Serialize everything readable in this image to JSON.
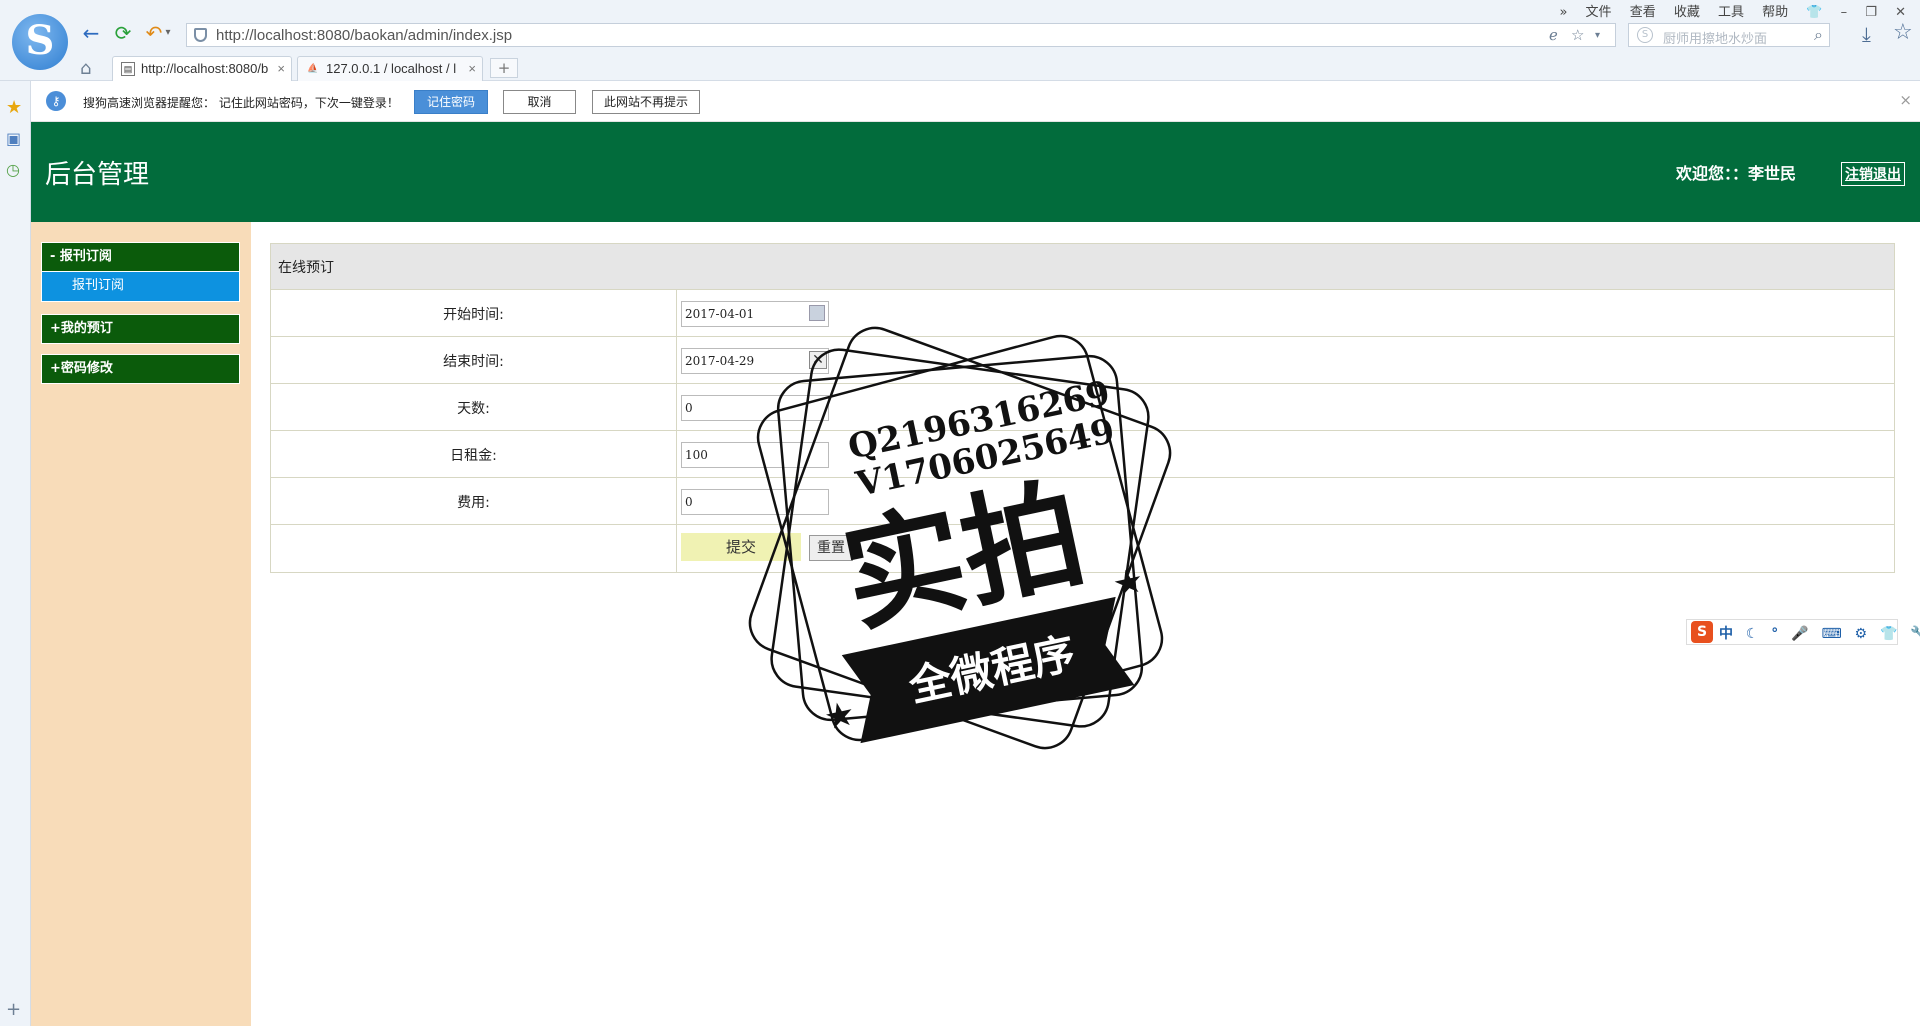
{
  "browser": {
    "url": "http://localhost:8080/baokan/admin/index.jsp",
    "search_placeholder": "厨师用擦地水炒面",
    "menu": [
      "文件",
      "查看",
      "收藏",
      "工具",
      "帮助"
    ],
    "tabs": [
      {
        "label": "http://localhost:8080/b",
        "close": "×"
      },
      {
        "label": "127.0.0.1 / localhost / l",
        "close": "×"
      }
    ],
    "new_tab": "+"
  },
  "infobar": {
    "message": "搜狗高速浏览器提醒您： 记住此网站密码，下次一键登录！",
    "remember": "记住密码",
    "cancel": "取消",
    "never": "此网站不再提示",
    "close": "×"
  },
  "header": {
    "title": "后台管理",
    "welcome": "欢迎您：：李世民",
    "logout": "注销退出"
  },
  "sidebar": {
    "items": [
      {
        "label": "- 报刊订阅",
        "sub": "报刊订阅"
      },
      {
        "label": "+我的预订"
      },
      {
        "label": "+密码修改"
      }
    ]
  },
  "form": {
    "title": "在线预订",
    "fields": [
      {
        "label": "开始时间:",
        "value": "2017-04-01"
      },
      {
        "label": "结束时间:",
        "value": "2017-04-29"
      },
      {
        "label": "天数:",
        "value": "0"
      },
      {
        "label": "日租金:",
        "value": "100"
      },
      {
        "label": "费用:",
        "value": "0"
      }
    ],
    "submit": "提交",
    "reset": "重置"
  },
  "ime": {
    "logo": "S",
    "label": "中"
  },
  "watermark": {
    "line1": "Q2196316269",
    "line2": "V1706025649",
    "main": "实拍",
    "banner": "全微程序"
  },
  "colors": {
    "header_bg": "#026c3c",
    "menu_head": "#0b5b0b",
    "menu_active": "#0d92e0",
    "sidebar_bg": "#f8dcb9"
  }
}
